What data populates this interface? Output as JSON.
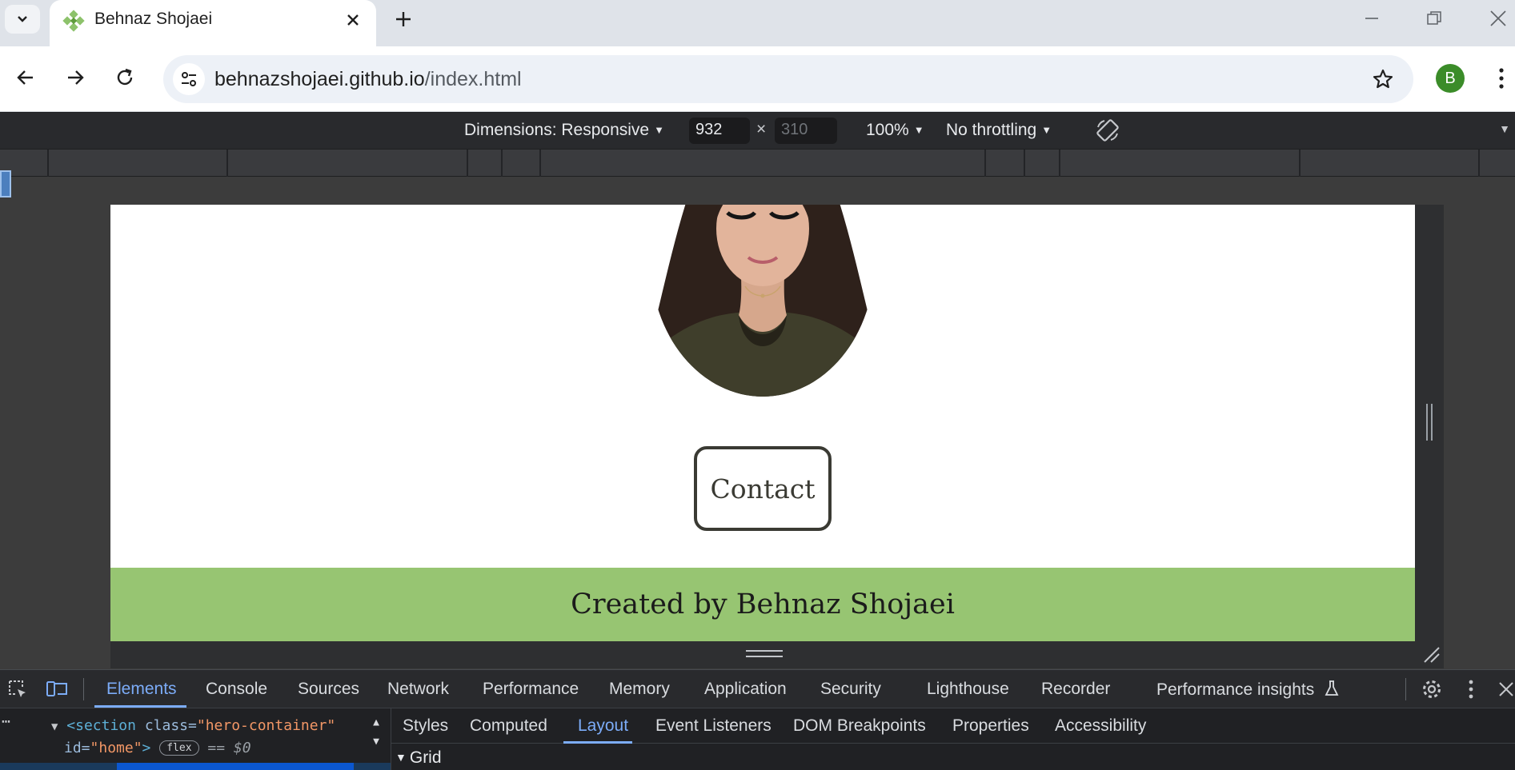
{
  "browser": {
    "tab_title": "Behnaz Shojaei",
    "url_host": "behnazshojaei.github.io",
    "url_path": "/index.html",
    "profile_initial": "B",
    "profile_color": "#3b8c29"
  },
  "device_toolbar": {
    "dimensions_label": "Dimensions: Responsive",
    "width_value": "932",
    "height_placeholder": "310",
    "times": "×",
    "zoom": "100%",
    "throttling": "No throttling"
  },
  "page": {
    "contact_label": "Contact",
    "footer_text": "Created by Behnaz Shojaei",
    "footer_color": "#97c572"
  },
  "devtools": {
    "tabs": [
      "Elements",
      "Console",
      "Sources",
      "Network",
      "Performance",
      "Memory",
      "Application",
      "Security",
      "Lighthouse",
      "Recorder",
      "Performance insights"
    ],
    "active_tab": "Elements",
    "elements": {
      "tag_open": "<section",
      "attr_class": "class=",
      "val_class": "\"hero-container\"",
      "attr_id": "id=",
      "val_id": "\"home\"",
      "tag_close": ">",
      "badge": "flex",
      "selected_marker": "== $0"
    },
    "sub_tabs": [
      "Styles",
      "Computed",
      "Layout",
      "Event Listeners",
      "DOM Breakpoints",
      "Properties",
      "Accessibility"
    ],
    "active_sub_tab": "Layout",
    "section_label": "Grid"
  }
}
